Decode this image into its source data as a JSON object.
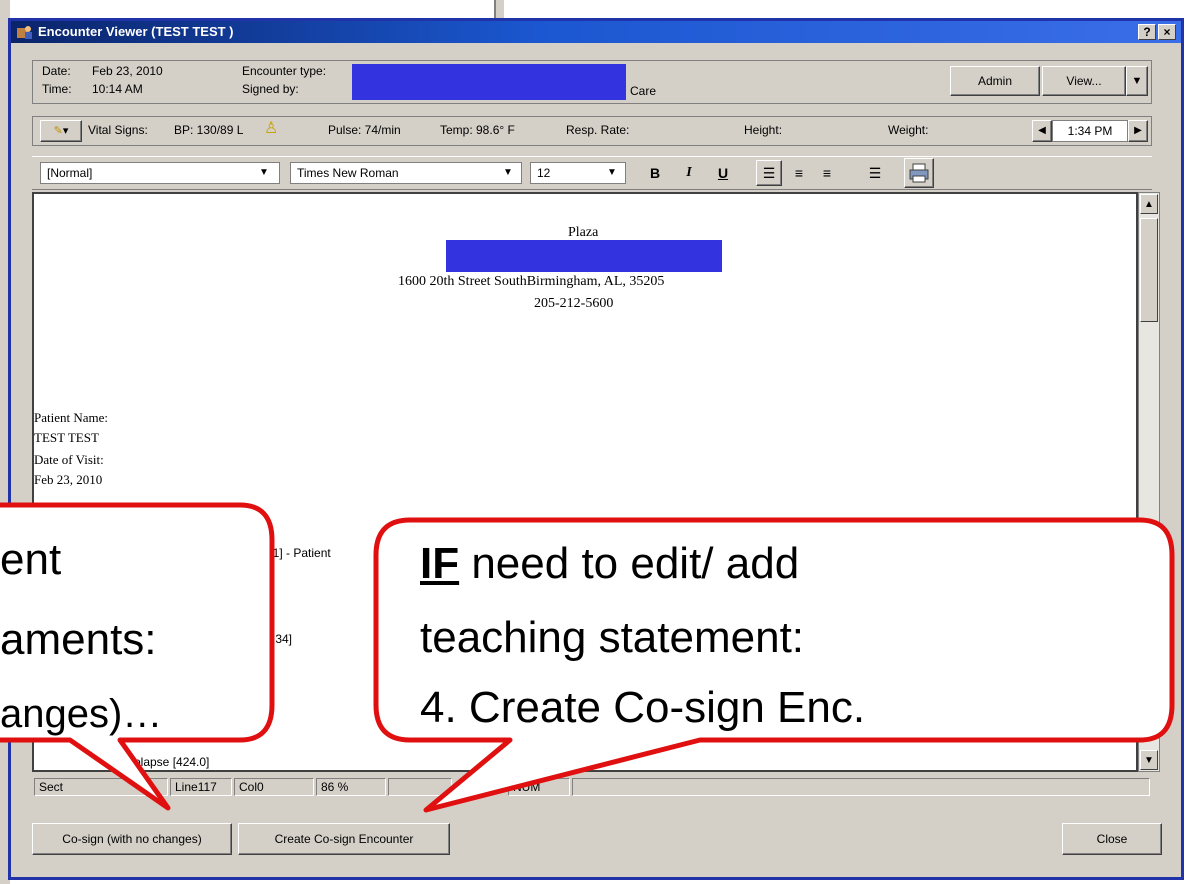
{
  "window": {
    "title": "Encounter Viewer (TEST TEST )",
    "help_label": "?",
    "close_label": "×"
  },
  "header": {
    "date_label": "Date:",
    "date_value": "Feb 23, 2010",
    "time_label": "Time:",
    "time_value": "10:14 AM",
    "encounter_type_label": "Encounter type:",
    "signed_by_label": "Signed by:",
    "signed_by_suffix": "Care",
    "admin_label": "Admin",
    "view_label": "View..."
  },
  "vitals": {
    "label": "Vital Signs:",
    "bp": "BP: 130/89 L",
    "pulse": "Pulse: 74/min",
    "temp": "Temp: 98.6° F",
    "resp": "Resp. Rate:",
    "height": "Height:",
    "weight": "Weight:",
    "time": "1:34 PM"
  },
  "toolbar": {
    "style": "[Normal]",
    "font": "Times New Roman",
    "size": "12",
    "bold": "B",
    "italic": "I",
    "underline": "U"
  },
  "document": {
    "facility_name": "Plaza",
    "address": "1600 20th Street SouthBirmingham, AL, 35205",
    "phone": "205-212-5600",
    "patient_name_label": "Patient Name:",
    "patient_name": "TEST TEST",
    "date_of_visit_label": "Date of Visit:",
    "date_of_visit": "Feb 23, 2010",
    "line_fragment_1": "31.1] - Patient",
    "line_fragment_2": ".34]",
    "line_fragment_3": "rolapse [424.0]"
  },
  "statusbar": {
    "section": "Sect",
    "line": "Line117",
    "col": "Col0",
    "zoom": "86 %",
    "mode": "NUM"
  },
  "buttons": {
    "cosign": "Co-sign (with no changes)",
    "create_cosign": "Create Co-sign Encounter",
    "close": "Close"
  },
  "callouts": {
    "left_line1": "ent",
    "left_line2": "aments:",
    "left_line3": "anges)…",
    "right_if": "IF",
    "right_line1_rest": " need to edit/ add",
    "right_line2": "teaching statement:",
    "right_line3": "4. Create Co-sign Enc."
  },
  "colors": {
    "titlebar": "#0a246a",
    "redaction": "#3333e0",
    "callout_border": "#e01010"
  }
}
